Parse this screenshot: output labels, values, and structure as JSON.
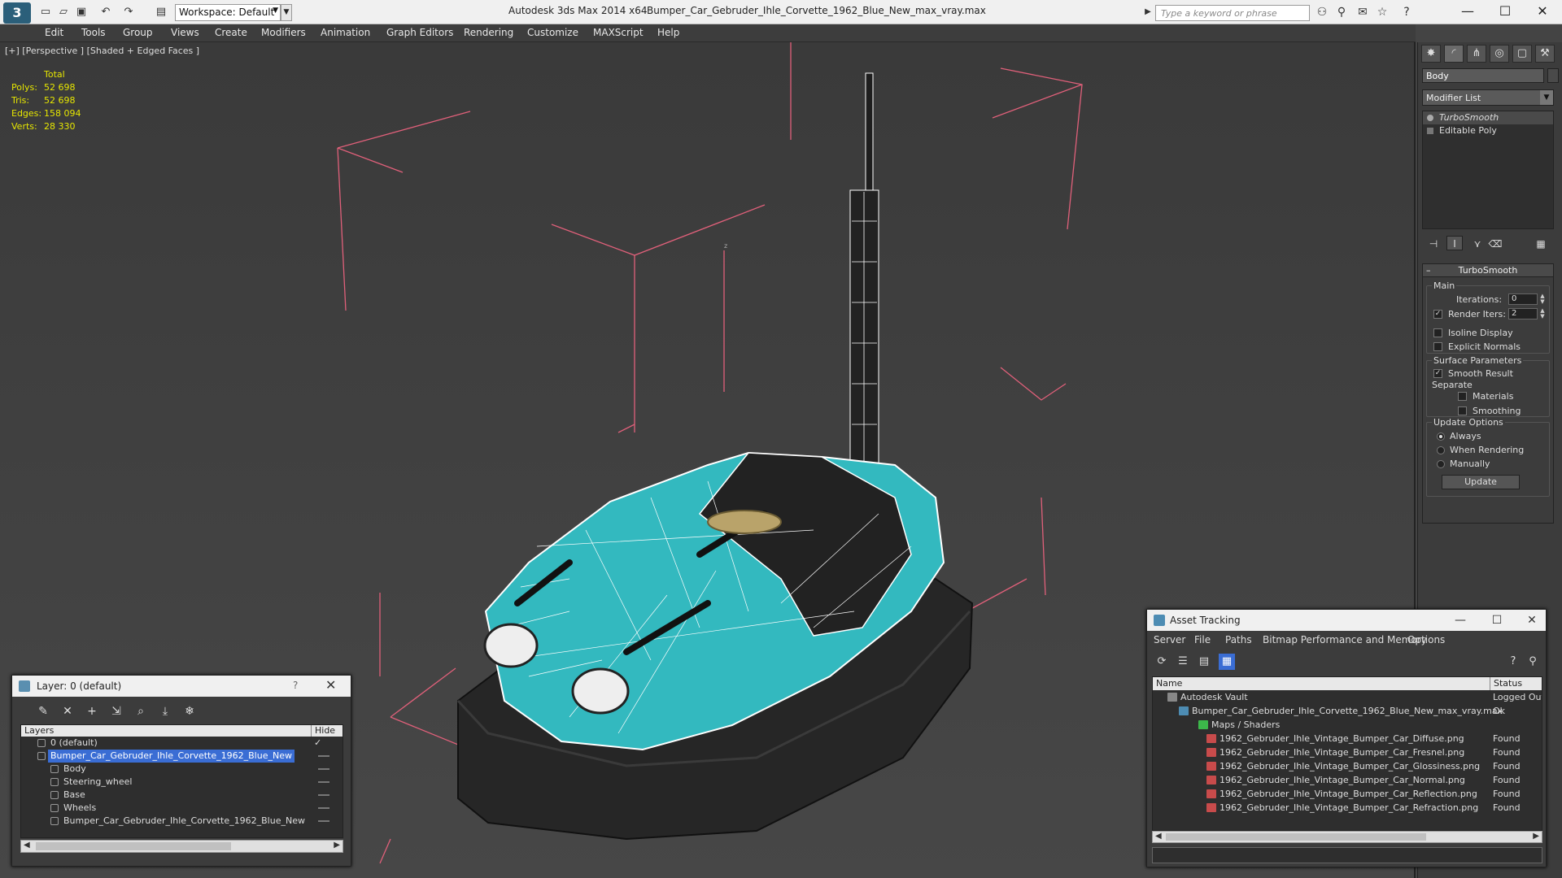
{
  "app": {
    "title": "Autodesk 3ds Max  2014 x64",
    "file": "Bumper_Car_Gebruder_Ihle_Corvette_1962_Blue_New_max_vray.max",
    "workspace": "Workspace: Default",
    "search_placeholder": "Type a keyword or phrase",
    "window_controls": [
      "—",
      "☐",
      "✕"
    ]
  },
  "menu": [
    "Edit",
    "Tools",
    "Group",
    "Views",
    "Create",
    "Modifiers",
    "Animation",
    "Graph Editors",
    "Rendering",
    "Customize",
    "MAXScript",
    "Help"
  ],
  "viewport": {
    "label": "[+] [Perspective ] [Shaded + Edged Faces ]",
    "stats": {
      "header": "Total",
      "rows": [
        {
          "k": "Polys:",
          "v": "52 698"
        },
        {
          "k": "Tris:",
          "v": "52 698"
        },
        {
          "k": "Edges:",
          "v": "158 094"
        },
        {
          "k": "Verts:",
          "v": "28 330"
        }
      ]
    },
    "axis_label": "z",
    "colors": {
      "body": "#33b9bf",
      "wire": "#ffffff",
      "base": "#262626",
      "bbox": "#e0607a"
    }
  },
  "command_panel": {
    "object_name": "Body",
    "modifier_list": "Modifier List",
    "stack": [
      "TurboSmooth",
      "Editable Poly"
    ],
    "rollout": {
      "title": "TurboSmooth",
      "main_title": "Main",
      "iterations_label": "Iterations:",
      "iterations": "0",
      "render_iters_label": "Render Iters:",
      "render_iters": "2",
      "isoline": "Isoline Display",
      "explicit_normals": "Explicit Normals",
      "surface_title": "Surface Parameters",
      "smooth_result": "Smooth Result",
      "separate": "Separate",
      "materials": "Materials",
      "smoothing_groups": "Smoothing Groups",
      "update_title": "Update Options",
      "always": "Always",
      "when_rendering": "When Rendering",
      "manually": "Manually",
      "update_button": "Update"
    }
  },
  "layer_dialog": {
    "title": "Layer: 0 (default)",
    "help": "?",
    "close": "✕",
    "col_layers": "Layers",
    "col_hide": "Hide",
    "rows": [
      {
        "name": "0 (default)",
        "indent": 0,
        "active": true
      },
      {
        "name": "Bumper_Car_Gebruder_Ihle_Corvette_1962_Blue_New",
        "indent": 0,
        "selected": true
      },
      {
        "name": "Body",
        "indent": 1
      },
      {
        "name": "Steering_wheel",
        "indent": 1
      },
      {
        "name": "Base",
        "indent": 1
      },
      {
        "name": "Wheels",
        "indent": 1
      },
      {
        "name": "Bumper_Car_Gebruder_Ihle_Corvette_1962_Blue_New",
        "indent": 1
      }
    ]
  },
  "asset_dialog": {
    "title": "Asset Tracking",
    "menu": [
      "Server",
      "File",
      "Paths",
      "Bitmap Performance and Memory",
      "Options"
    ],
    "col_name": "Name",
    "col_status": "Status",
    "rows": [
      {
        "name": "Autodesk Vault",
        "status": "Logged Out",
        "indent": 0,
        "kind": "vault"
      },
      {
        "name": "Bumper_Car_Gebruder_Ihle_Corvette_1962_Blue_New_max_vray.max",
        "status": "Ok",
        "indent": 1,
        "kind": "max"
      },
      {
        "name": "Maps / Shaders",
        "status": "",
        "indent": 2,
        "kind": "folder"
      },
      {
        "name": "1962_Gebruder_Ihle_Vintage_Bumper_Car_Diffuse.png",
        "status": "Found",
        "indent": 3,
        "kind": "png"
      },
      {
        "name": "1962_Gebruder_Ihle_Vintage_Bumper_Car_Fresnel.png",
        "status": "Found",
        "indent": 3,
        "kind": "png"
      },
      {
        "name": "1962_Gebruder_Ihle_Vintage_Bumper_Car_Glossiness.png",
        "status": "Found",
        "indent": 3,
        "kind": "png"
      },
      {
        "name": "1962_Gebruder_Ihle_Vintage_Bumper_Car_Normal.png",
        "status": "Found",
        "indent": 3,
        "kind": "png"
      },
      {
        "name": "1962_Gebruder_Ihle_Vintage_Bumper_Car_Reflection.png",
        "status": "Found",
        "indent": 3,
        "kind": "png"
      },
      {
        "name": "1962_Gebruder_Ihle_Vintage_Bumper_Car_Refraction.png",
        "status": "Found",
        "indent": 3,
        "kind": "png"
      }
    ]
  }
}
